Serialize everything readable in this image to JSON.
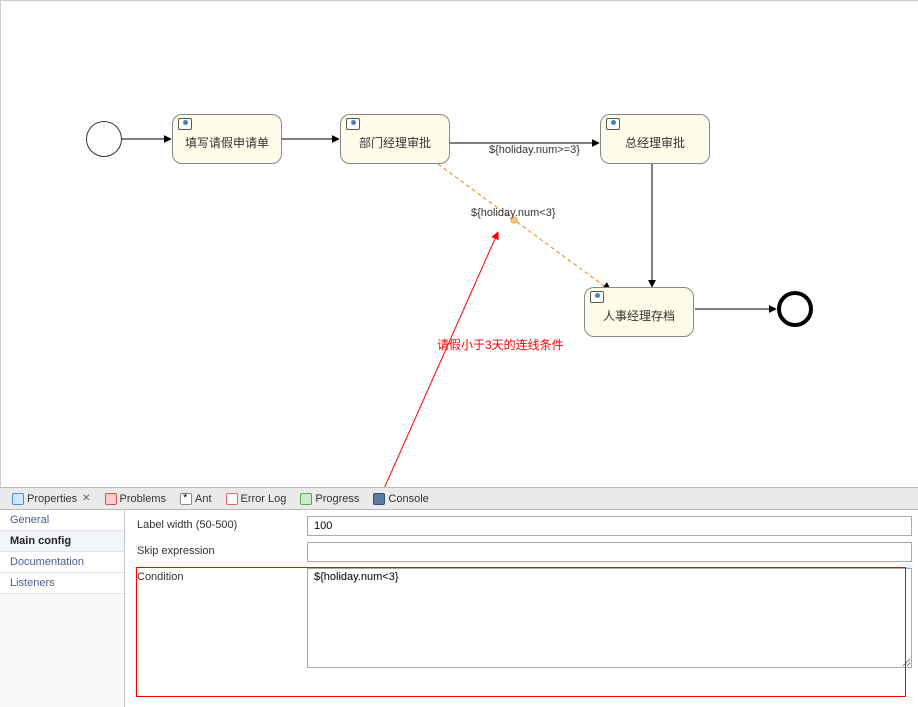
{
  "chart_data": {
    "type": "bpmn-process",
    "nodes": [
      {
        "id": "start",
        "type": "startEvent",
        "label": ""
      },
      {
        "id": "t1",
        "type": "userTask",
        "label": "填写请假申请单"
      },
      {
        "id": "t2",
        "type": "userTask",
        "label": "部门经理审批"
      },
      {
        "id": "t3",
        "type": "userTask",
        "label": "总经理审批"
      },
      {
        "id": "t4",
        "type": "userTask",
        "label": "人事经理存档"
      },
      {
        "id": "end",
        "type": "endEvent",
        "label": ""
      }
    ],
    "flows": [
      {
        "from": "start",
        "to": "t1",
        "condition": "",
        "style": "solid"
      },
      {
        "from": "t1",
        "to": "t2",
        "condition": "",
        "style": "solid"
      },
      {
        "from": "t2",
        "to": "t3",
        "condition": "${holiday.num>=3}",
        "style": "solid"
      },
      {
        "from": "t2",
        "to": "t4",
        "condition": "${holiday.num<3}",
        "style": "dashed"
      },
      {
        "from": "t3",
        "to": "t4",
        "condition": "",
        "style": "solid"
      },
      {
        "from": "t4",
        "to": "end",
        "condition": "",
        "style": "solid"
      }
    ],
    "annotation": "请假小于3天的连线条件"
  },
  "tasks": {
    "t1": "填写请假申请单",
    "t2": "部门经理审批",
    "t3": "总经理审批",
    "t4": "人事经理存档"
  },
  "flowLabels": {
    "f_t2_t3": "${holiday.num>=3}",
    "f_t2_t4": "${holiday.num<3}"
  },
  "annotation": "请假小于3天的连线条件",
  "views": {
    "properties": "Properties",
    "problems": "Problems",
    "ant": "Ant",
    "errorLog": "Error Log",
    "progress": "Progress",
    "console": "Console"
  },
  "propTabs": {
    "general": "General",
    "mainConfig": "Main config",
    "documentation": "Documentation",
    "listeners": "Listeners"
  },
  "fields": {
    "labelWidth": {
      "label": "Label width (50-500)",
      "value": "100"
    },
    "skipExpression": {
      "label": "Skip expression",
      "value": ""
    },
    "condition": {
      "label": "Condition",
      "value": "${holiday.num<3}"
    }
  }
}
